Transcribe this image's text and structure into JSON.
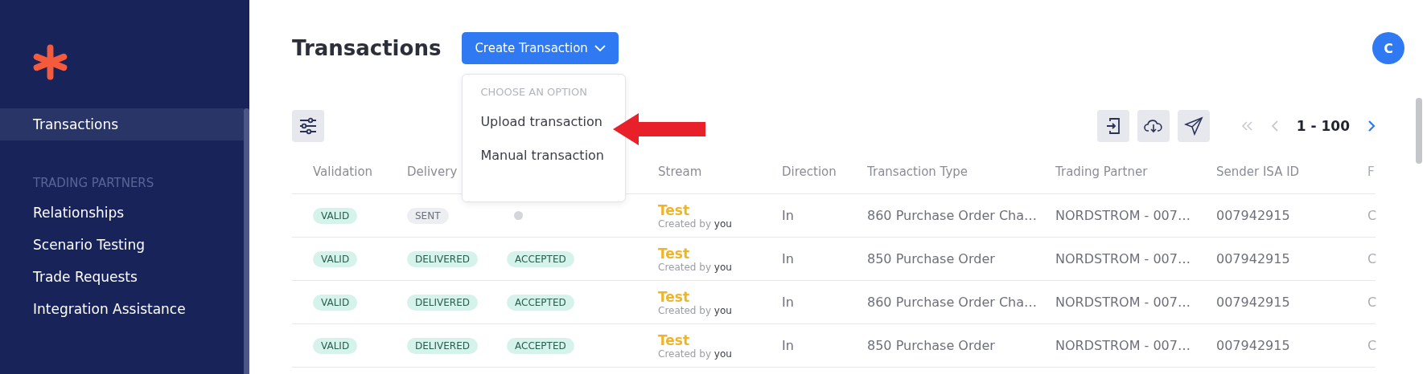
{
  "sidebar": {
    "items": [
      {
        "label": "Transactions",
        "selected": true
      }
    ],
    "section": {
      "title": "TRADING PARTNERS",
      "items": [
        {
          "label": "Relationships",
          "selected": false
        },
        {
          "label": "Scenario Testing",
          "selected": false
        },
        {
          "label": "Trade Requests",
          "selected": false
        },
        {
          "label": "Integration Assistance",
          "selected": false
        }
      ]
    }
  },
  "header": {
    "title": "Transactions",
    "create_button": "Create Transaction",
    "avatar": "C"
  },
  "dropdown": {
    "heading": "CHOOSE AN OPTION",
    "options": [
      "Upload transaction",
      "Manual transaction"
    ]
  },
  "pagination": {
    "range": "1 - 100"
  },
  "table": {
    "columns": [
      "Validation",
      "Delivery",
      "",
      "Stream",
      "Direction",
      "Transaction Type",
      "Trading Partner",
      "Sender ISA ID",
      "F"
    ],
    "rows": [
      {
        "validation": "VALID",
        "delivery": {
          "label": "SENT",
          "kind": "grey"
        },
        "column_3": {
          "kind": "dot"
        },
        "stream": "Test",
        "created_prefix": "Created by",
        "created_by": "you",
        "direction": "In",
        "type": "860 Purchase Order Cha…",
        "partner": "NORDSTROM - 007…",
        "sender": "007942915",
        "column_9": "C"
      },
      {
        "validation": "VALID",
        "delivery": {
          "label": "DELIVERED",
          "kind": "green"
        },
        "column_3": {
          "kind": "pill",
          "label": "ACCEPTED"
        },
        "stream": "Test",
        "created_prefix": "Created by",
        "created_by": "you",
        "direction": "In",
        "type": "850 Purchase Order",
        "partner": "NORDSTROM - 007…",
        "sender": "007942915",
        "column_9": "C"
      },
      {
        "validation": "VALID",
        "delivery": {
          "label": "DELIVERED",
          "kind": "green"
        },
        "column_3": {
          "kind": "pill",
          "label": "ACCEPTED"
        },
        "stream": "Test",
        "created_prefix": "Created by",
        "created_by": "you",
        "direction": "In",
        "type": "860 Purchase Order Cha…",
        "partner": "NORDSTROM - 007…",
        "sender": "007942915",
        "column_9": "C"
      },
      {
        "validation": "VALID",
        "delivery": {
          "label": "DELIVERED",
          "kind": "green"
        },
        "column_3": {
          "kind": "pill",
          "label": "ACCEPTED"
        },
        "stream": "Test",
        "created_prefix": "Created by",
        "created_by": "you",
        "direction": "In",
        "type": "850 Purchase Order",
        "partner": "NORDSTROM - 007…",
        "sender": "007942915",
        "column_9": "C"
      }
    ]
  }
}
